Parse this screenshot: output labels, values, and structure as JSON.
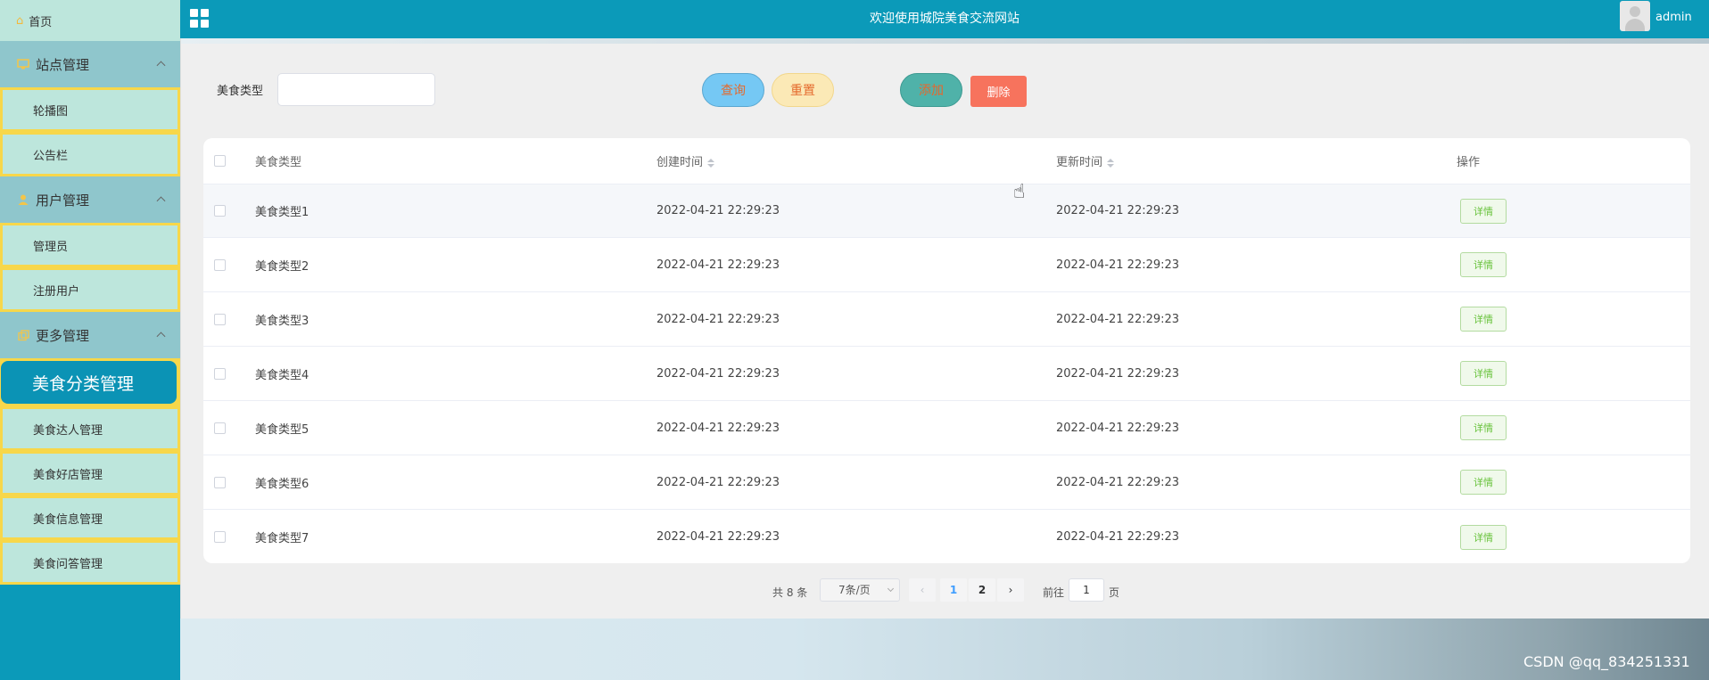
{
  "sidebar": {
    "home": "首页",
    "groups": [
      {
        "title": "站点管理",
        "items": [
          "轮播图",
          "公告栏"
        ]
      },
      {
        "title": "用户管理",
        "items": [
          "管理员",
          "注册用户"
        ]
      },
      {
        "title": "更多管理",
        "items": [
          "美食分类管理",
          "美食达人管理",
          "美食好店管理",
          "美食信息管理",
          "美食问答管理"
        ]
      }
    ],
    "active_item": "美食分类管理"
  },
  "header": {
    "title": "欢迎使用城院美食交流网站",
    "user": "admin"
  },
  "search": {
    "label": "美食类型",
    "value": "",
    "buttons": {
      "query": "查询",
      "reset": "重置",
      "add": "添加",
      "delete": "删除"
    }
  },
  "table": {
    "columns": {
      "type": "美食类型",
      "created": "创建时间",
      "updated": "更新时间",
      "action": "操作"
    },
    "rows": [
      {
        "type": "美食类型1",
        "created": "2022-04-21 22:29:23",
        "updated": "2022-04-21 22:29:23",
        "action": "详情"
      },
      {
        "type": "美食类型2",
        "created": "2022-04-21 22:29:23",
        "updated": "2022-04-21 22:29:23",
        "action": "详情"
      },
      {
        "type": "美食类型3",
        "created": "2022-04-21 22:29:23",
        "updated": "2022-04-21 22:29:23",
        "action": "详情"
      },
      {
        "type": "美食类型4",
        "created": "2022-04-21 22:29:23",
        "updated": "2022-04-21 22:29:23",
        "action": "详情"
      },
      {
        "type": "美食类型5",
        "created": "2022-04-21 22:29:23",
        "updated": "2022-04-21 22:29:23",
        "action": "详情"
      },
      {
        "type": "美食类型6",
        "created": "2022-04-21 22:29:23",
        "updated": "2022-04-21 22:29:23",
        "action": "详情"
      },
      {
        "type": "美食类型7",
        "created": "2022-04-21 22:29:23",
        "updated": "2022-04-21 22:29:23",
        "action": "详情"
      }
    ]
  },
  "pagination": {
    "total": "共 8 条",
    "page_size": "7条/页",
    "pages": [
      "1",
      "2"
    ],
    "current_page": "1",
    "goto_label": "前往",
    "goto_value": "1",
    "page_unit": "页"
  },
  "watermark": "CSDN @qq_834251331",
  "colors": {
    "primary": "#0b9ab9",
    "sidebar_item_bg": "#bde6dc",
    "sidebar_border": "#f7d74a",
    "group_bg": "#8fc6cc",
    "delete": "#f7735d"
  }
}
